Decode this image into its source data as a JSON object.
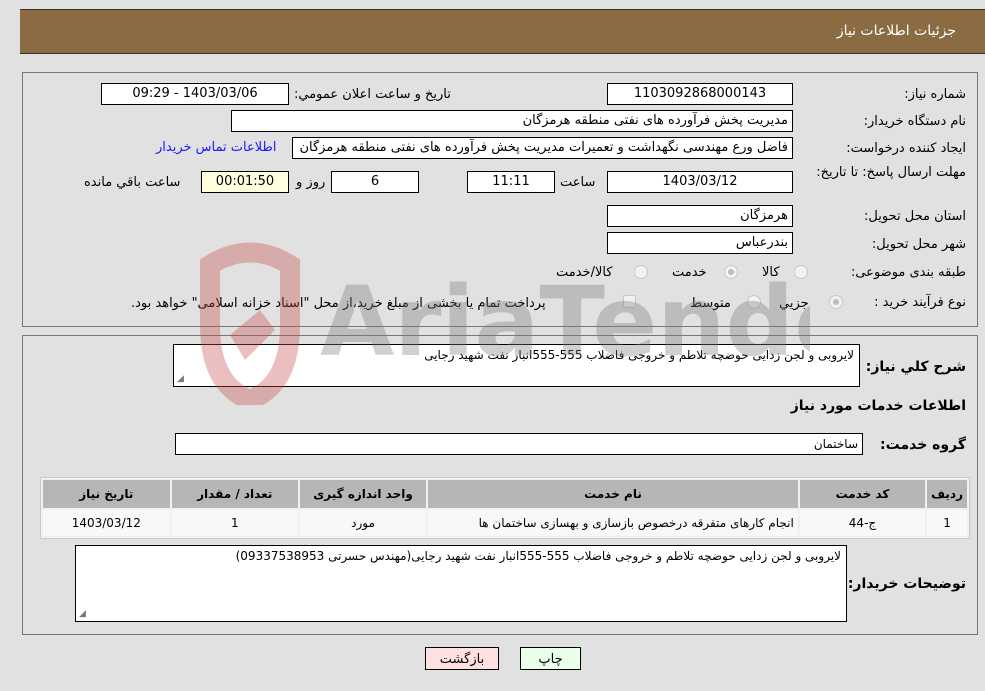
{
  "header": {
    "title": "جزئیات اطلاعات نیاز"
  },
  "form": {
    "need_number": {
      "label": "شماره نیاز:",
      "value": "1103092868000143"
    },
    "announce_datetime": {
      "label": "تاریخ و ساعت اعلان عمومي:",
      "value": "1403/03/06 - 09:29"
    },
    "buyer_org": {
      "label": "نام دستگاه خريدار:",
      "value": "مدیریت پخش فرآورده های نفتی منطقه هرمزگان"
    },
    "requester": {
      "label": "ايجاد کننده درخواست:",
      "value": "فاضل ورع مهندسی نگهداشت و تعمیرات مدیریت پخش فرآورده های نفتی منطقه هرمزگان",
      "contact_link": "اطلاعات تماس خریدار"
    },
    "deadline": {
      "label": "مهلت ارسال پاسخ: تا تاریخ:",
      "date": "1403/03/12",
      "time_label": "ساعت",
      "time": "11:11",
      "days": "6",
      "days_label": "روز و",
      "remaining": "00:01:50",
      "remaining_label": "ساعت باقي مانده"
    },
    "province": {
      "label": "استان محل تحويل:",
      "value": "هرمزگان"
    },
    "city": {
      "label": "شهر محل تحويل:",
      "value": "بندرعباس"
    },
    "category": {
      "label": "طبقه بندی موضوعی:",
      "options": [
        "کالا",
        "خدمت",
        "کالا/خدمت"
      ],
      "selected": "خدمت"
    },
    "purchase_type": {
      "label": "نوع فرآيند خريد :",
      "options": [
        "جزيي",
        "متوسط"
      ],
      "selected": "جزيي",
      "treasury_note": "پرداخت تمام یا بخشی از مبلغ خرید،از محل \"اسناد خزانه اسلامی\" خواهد بود."
    }
  },
  "details": {
    "summary_label": "شرح کلي نياز:",
    "summary": "لایروبی و لجن زدایی حوضچه تلاطم و خروجی فاضلاب  555-555انبار نفت شهید رجایی",
    "services_heading": "اطلاعات خدمات مورد نياز",
    "service_group_label": "گروه خدمت:",
    "service_group": "ساختمان",
    "table": {
      "headers": [
        "رديف",
        "کد خدمت",
        "نام خدمت",
        "واحد اندازه گيری",
        "تعداد / مقدار",
        "تاريخ نياز"
      ],
      "rows": [
        [
          "1",
          "ج-44",
          "انجام کارهای متفرقه درخصوص بازسازی و بهسازی ساختمان ها",
          "مورد",
          "1",
          "1403/03/12"
        ]
      ]
    },
    "buyer_notes_label": "توضيحات خريدار:",
    "buyer_notes": "لایروبی و لجن زدایی حوضچه تلاطم و خروجی فاضلاب  555-555انبار نفت شهید رجایی(مهندس حسرتی 09337538953)"
  },
  "buttons": {
    "print": "چاپ",
    "back": "بازگشت"
  },
  "watermark": {
    "text": "AriaTender.neT"
  }
}
